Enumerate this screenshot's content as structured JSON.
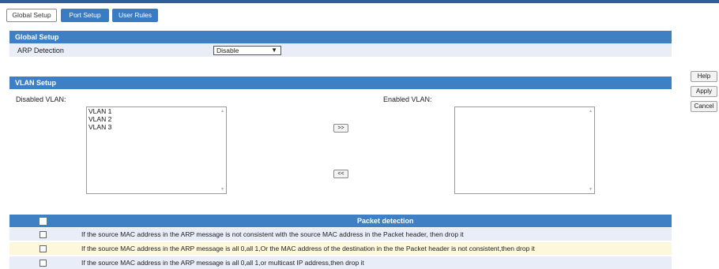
{
  "tabs": [
    {
      "label": "Global Setup",
      "active": true
    },
    {
      "label": "Port Setup",
      "active": false
    },
    {
      "label": "User Rules",
      "active": false
    }
  ],
  "global_setup": {
    "header": "Global Setup",
    "arp_label": "ARP Detection",
    "arp_value": "Disable"
  },
  "vlan_setup": {
    "header": "VLAN Setup",
    "disabled_label": "Disabled VLAN:",
    "enabled_label": "Enabled VLAN:",
    "disabled_items": [
      "VLAN 1",
      "VLAN 2",
      "VLAN 3"
    ],
    "enabled_items": [],
    "move_right": ">>",
    "move_left": "<<"
  },
  "side_buttons": {
    "help": "Help",
    "apply": "Apply",
    "cancel": "Cancel"
  },
  "packet_detection": {
    "header": "Packet detection",
    "rows": [
      {
        "text": "If the source MAC address in the ARP message is not consistent with the source MAC address in the Packet header, then drop it",
        "checked": false
      },
      {
        "text": "If the source MAC address in the ARP message is all 0,all 1,Or the MAC address of the destination in the the Packet header is not consistent,then drop it",
        "checked": false
      },
      {
        "text": "If the source MAC address in the ARP message is all 0,all 1,or multicast IP address,then drop it",
        "checked": false
      }
    ]
  },
  "colors": {
    "header_blue": "#3f7fc4",
    "row_light": "#e8edf8",
    "row_highlight": "#fdf8dc"
  }
}
